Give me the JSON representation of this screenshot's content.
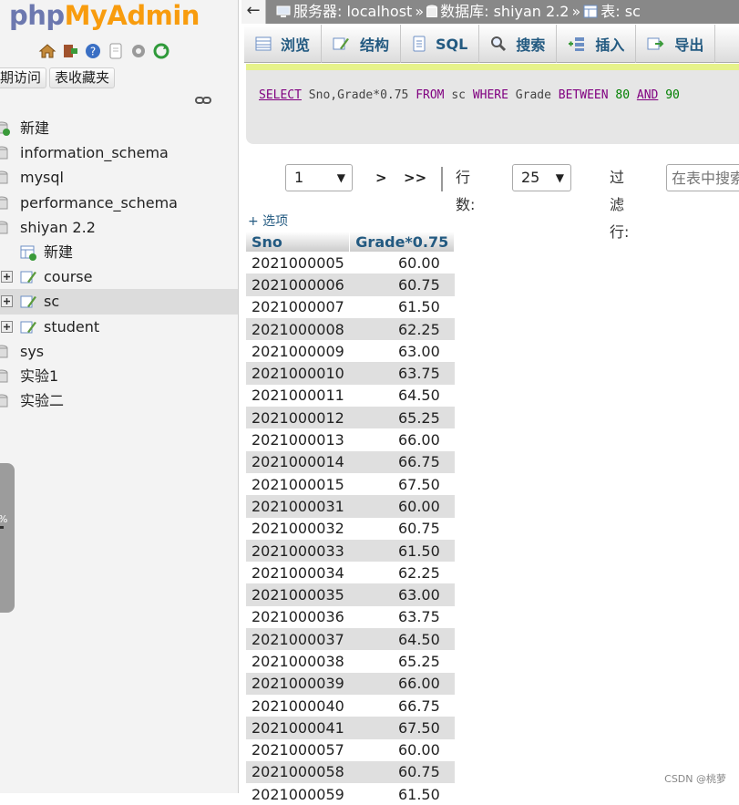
{
  "nav": {
    "logo_part1": "php",
    "logo_part2": "MyAdmin",
    "buttons": [
      "期访问",
      "表收藏夹"
    ],
    "tree": [
      {
        "label": "新建",
        "level": 0
      },
      {
        "label": "information_schema",
        "level": 0
      },
      {
        "label": "mysql",
        "level": 0
      },
      {
        "label": "performance_schema",
        "level": 0
      },
      {
        "label": "shiyan 2.2",
        "level": 0
      },
      {
        "label": "新建",
        "level": 1
      },
      {
        "label": "course",
        "level": 1
      },
      {
        "label": "sc",
        "level": 1
      },
      {
        "label": "student",
        "level": 1
      },
      {
        "label": "sys",
        "level": 0
      },
      {
        "label": "实验1",
        "level": 0
      },
      {
        "label": "实验二",
        "level": 0
      }
    ],
    "scroll_text": "%"
  },
  "breadcrumb": {
    "back": "←",
    "server": "服务器: localhost",
    "database": "数据库: shiyan 2.2",
    "table": "表: sc",
    "sep": "»"
  },
  "tabs": [
    "浏览",
    "结构",
    "SQL",
    "搜索",
    "插入",
    "导出"
  ],
  "sql": {
    "select": "SELECT",
    "cols": "Sno,Grade*0.75",
    "from": "FROM",
    "table": "sc",
    "where": "WHERE",
    "field": "Grade",
    "between": "BETWEEN",
    "low": "80",
    "and": "AND",
    "high": "90"
  },
  "pager": {
    "page": "1",
    "next": ">",
    "last": ">>",
    "rows_label": "行数:",
    "rows_value": "25",
    "filter_label": "过滤行:",
    "filter_placeholder": "在表中搜索"
  },
  "options_label": "+ 选项",
  "table": {
    "headers": [
      "Sno",
      "Grade*0.75"
    ],
    "rows": [
      [
        "2021000005",
        "60.00"
      ],
      [
        "2021000006",
        "60.75"
      ],
      [
        "2021000007",
        "61.50"
      ],
      [
        "2021000008",
        "62.25"
      ],
      [
        "2021000009",
        "63.00"
      ],
      [
        "2021000010",
        "63.75"
      ],
      [
        "2021000011",
        "64.50"
      ],
      [
        "2021000012",
        "65.25"
      ],
      [
        "2021000013",
        "66.00"
      ],
      [
        "2021000014",
        "66.75"
      ],
      [
        "2021000015",
        "67.50"
      ],
      [
        "2021000031",
        "60.00"
      ],
      [
        "2021000032",
        "60.75"
      ],
      [
        "2021000033",
        "61.50"
      ],
      [
        "2021000034",
        "62.25"
      ],
      [
        "2021000035",
        "63.00"
      ],
      [
        "2021000036",
        "63.75"
      ],
      [
        "2021000037",
        "64.50"
      ],
      [
        "2021000038",
        "65.25"
      ],
      [
        "2021000039",
        "66.00"
      ],
      [
        "2021000040",
        "66.75"
      ],
      [
        "2021000041",
        "67.50"
      ],
      [
        "2021000057",
        "60.00"
      ],
      [
        "2021000058",
        "60.75"
      ],
      [
        "2021000059",
        "61.50"
      ]
    ]
  },
  "watermark": "CSDN @桃萝"
}
